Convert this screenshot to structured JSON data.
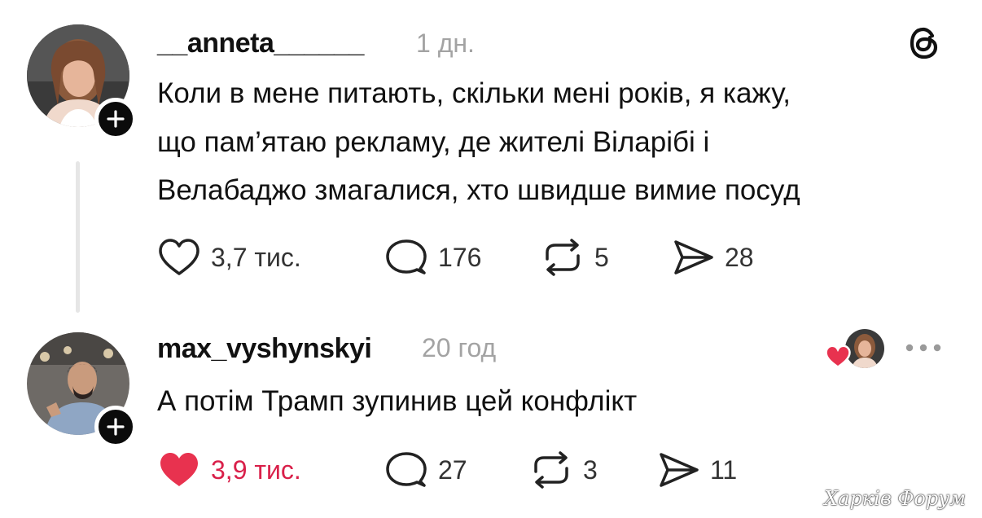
{
  "post": {
    "username": "__anneta______",
    "time": "1 дн.",
    "text_lines": [
      "Коли в мене питають, скільки мені років, я кажу,",
      "що пам’ятаю рекламу, де жителі Віларібі і",
      "Велабаджо змагалися, хто швидше вимие посуд"
    ],
    "likes": "3,7 тис.",
    "comments": "176",
    "reposts": "5",
    "shares": "28"
  },
  "reply": {
    "username": "max_vyshynskyi",
    "time": "20 год",
    "text": "А потім Трамп зупинив цей конфлікт",
    "likes": "3,9 тис.",
    "liked": true,
    "comments": "27",
    "reposts": "3",
    "shares": "11"
  },
  "icons": {
    "app_logo": "threads-logo-icon",
    "like": "heart-icon",
    "comment": "comment-bubble-icon",
    "repost": "repost-icon",
    "share": "send-icon",
    "more": "more-options-icon",
    "follow": "plus-icon"
  },
  "colors": {
    "liked": "#d9204a",
    "secondary_text": "#a3a3a3"
  },
  "watermark": "Харків Форум"
}
